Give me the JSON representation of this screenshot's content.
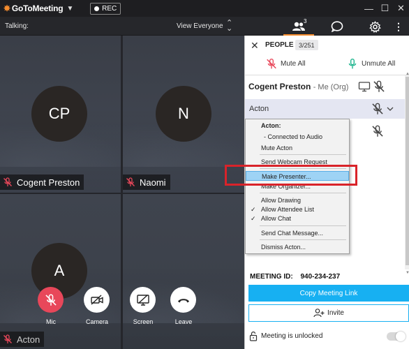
{
  "app": {
    "title": "GoToMeeting",
    "rec_label": "REC"
  },
  "toolbar": {
    "talking_label": "Talking:",
    "view_label": "View Everyone",
    "people_count": "3"
  },
  "tiles": [
    {
      "initials": "CP",
      "name": "Cogent Preston"
    },
    {
      "initials": "N",
      "name": "Naomi"
    },
    {
      "initials": "A",
      "name": "Acton"
    }
  ],
  "controls": [
    {
      "label": "Mic",
      "icon": "mic-muted-icon"
    },
    {
      "label": "Camera",
      "icon": "camera-off-icon"
    },
    {
      "label": "Screen",
      "icon": "screen-off-icon"
    },
    {
      "label": "Leave",
      "icon": "phone-hangup-icon"
    }
  ],
  "panel": {
    "title": "PEOPLE",
    "count": "3/251",
    "mute_all": "Mute All",
    "unmute_all": "Unmute All",
    "self_name": "Cogent Preston",
    "self_suffix": "- Me (Org)",
    "selected_name": "Acton",
    "meeting_id_label": "MEETING ID:",
    "meeting_id": "940-234-237",
    "copy_link": "Copy Meeting Link",
    "invite": "Invite",
    "lock_status": "Meeting is unlocked"
  },
  "context_menu": {
    "header": "Acton:",
    "status": "- Connected to Audio",
    "items": [
      "Mute Acton",
      "Send Webcam Request",
      "Make Presenter...",
      "Make Organizer...",
      "Allow Drawing",
      "Allow Attendee List",
      "Allow Chat",
      "Send Chat Message...",
      "Dismiss Acton..."
    ],
    "highlighted": "Make Presenter...",
    "checked": [
      "Allow Attendee List",
      "Allow Chat"
    ]
  },
  "colors": {
    "accent_orange": "#f68d2e",
    "muted_red": "#e8475a",
    "link_blue": "#17b0f2",
    "highlight_box": "#d9232a"
  }
}
